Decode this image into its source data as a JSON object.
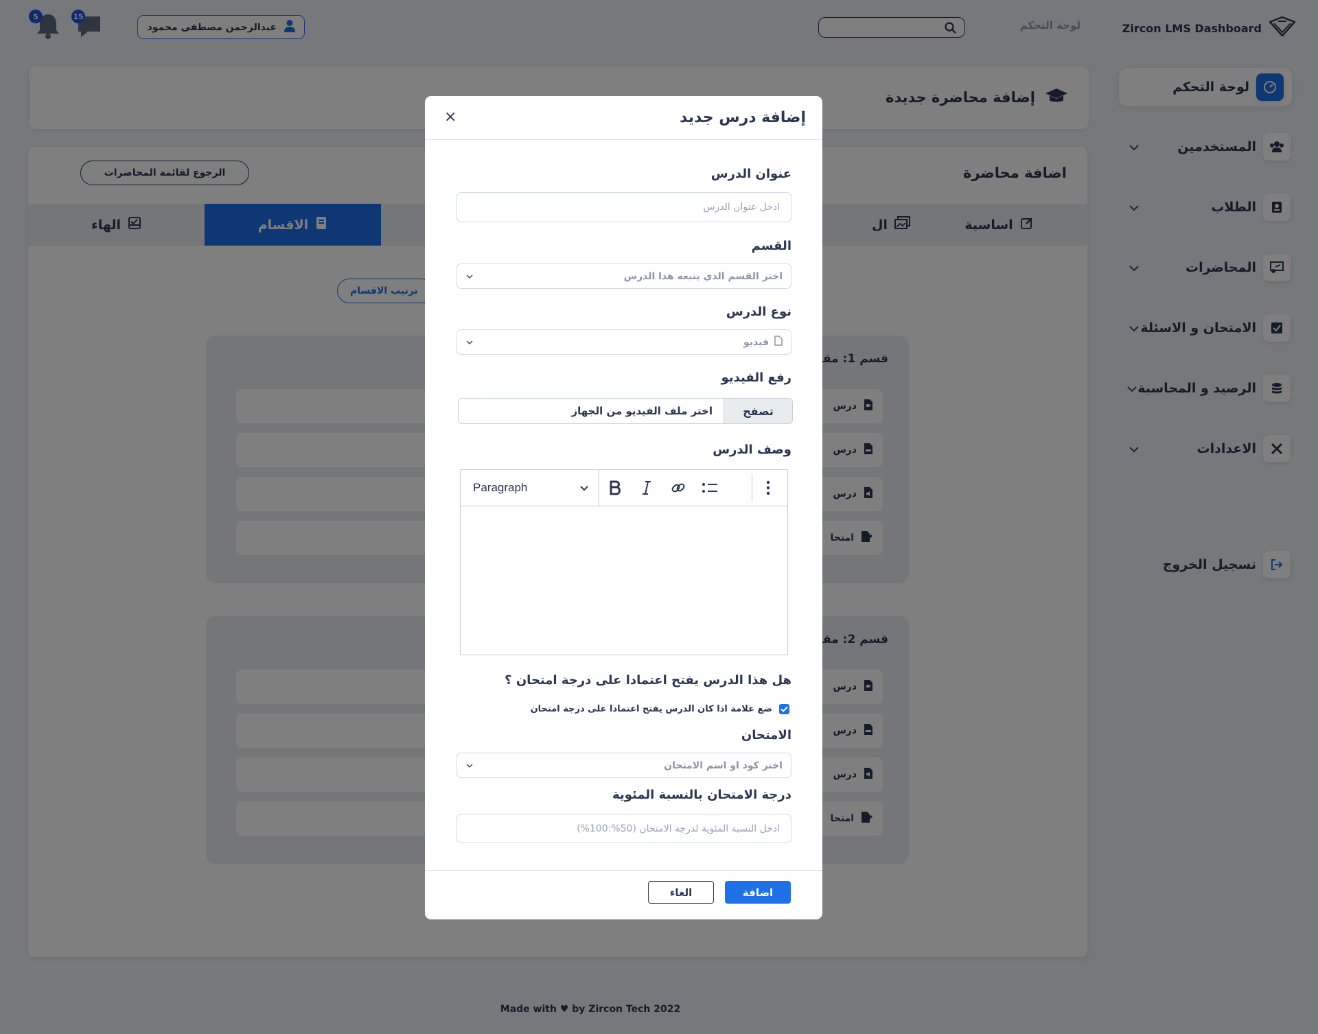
{
  "app": {
    "brand": "Zircon LMS Dashboard",
    "breadcrumb": "لوحة التحكم",
    "user_name": "عبدالرحمن مصطفى محمود",
    "messages_count": "15",
    "notifications_count": "5"
  },
  "sidebar": {
    "items": [
      {
        "label": "لوحة التحكم",
        "icon": "speedometer-icon",
        "active": true
      },
      {
        "label": "المستخدمين",
        "icon": "users-icon"
      },
      {
        "label": "الطلاب",
        "icon": "student-icon"
      },
      {
        "label": "المحاضرات",
        "icon": "presentation-icon"
      },
      {
        "label": "الامتحان و الاسئلة",
        "icon": "checkbox-icon"
      },
      {
        "label": "الرصيد و المحاسبة",
        "icon": "coins-icon"
      },
      {
        "label": "الاعدادات",
        "icon": "tools-icon"
      }
    ],
    "logout": "تسجيل الخروج"
  },
  "page": {
    "header_title": "إضافة محاضرة جديدة",
    "card_title": "اضافة محاضرة",
    "back_button": "الرجوع لقائمة المحاضرات",
    "tabs": [
      {
        "label": "اساسية",
        "icon": "edit-icon"
      },
      {
        "label": "ال",
        "icon": "images-icon"
      },
      {
        "label": "الاقسام",
        "icon": "book-icon",
        "active": true
      },
      {
        "label": "الهاء",
        "icon": "inbox-check-icon"
      }
    ],
    "order_button": "ترتيب الاقسام",
    "sections": [
      {
        "title": "قسم 1: مقد",
        "rows": [
          {
            "label": "درس",
            "icon": "video-file-icon"
          },
          {
            "label": "درس",
            "icon": "pdf-file-icon"
          },
          {
            "label": "درس",
            "icon": "audio-file-icon"
          },
          {
            "label": "امتحا",
            "icon": "exam-file-icon"
          }
        ]
      },
      {
        "title": "قسم 2: مقد",
        "rows": [
          {
            "label": "درس",
            "icon": "video-file-icon"
          },
          {
            "label": "درس",
            "icon": "pdf-file-icon"
          },
          {
            "label": "درس",
            "icon": "audio-file-icon"
          },
          {
            "label": "امتحا",
            "icon": "exam-file-icon"
          }
        ]
      }
    ],
    "footer": {
      "before": "Made with",
      "after": "by Zircon Tech 2022"
    }
  },
  "modal": {
    "title": "إضافة درس جديد",
    "close": "×",
    "lesson_title_label": "عنوان الدرس",
    "lesson_title_placeholder": "ادخل عنوان الدرس",
    "section_label": "القسم",
    "section_placeholder": "اختر القسم الذي يتبعه هذا الدرس",
    "type_label": "نوع الدرس",
    "type_value": "فيديو",
    "upload_label": "رفع الفيديو",
    "upload_placeholder": "اختر ملف الفيديو من الجهاز",
    "browse": "تصفح",
    "desc_label": "وصف الدرس",
    "editor_format": "Paragraph",
    "exam_question": "هل هذا الدرس يفتح اعتمادا على درجة امتحان ؟",
    "exam_checkbox_label": "ضع علامة اذا كان الدرس يفتح اعتمادا على درجة امتحان",
    "exam_checked": true,
    "exam_label": "الامتحان",
    "exam_placeholder": "اختر كود او اسم الامتحان",
    "percent_label": "درجة الامتحان بالنسبة المئوية",
    "percent_placeholder": "ادخل النسبة المئوية لدرجة الامتحان (50%:100%)",
    "add_button": "اضافة",
    "cancel_button": "الغاء"
  },
  "colors": {
    "accent": "#1f6fe6",
    "badge": "#1c55e0",
    "overlay": "rgba(0,0,0,0.5)"
  }
}
